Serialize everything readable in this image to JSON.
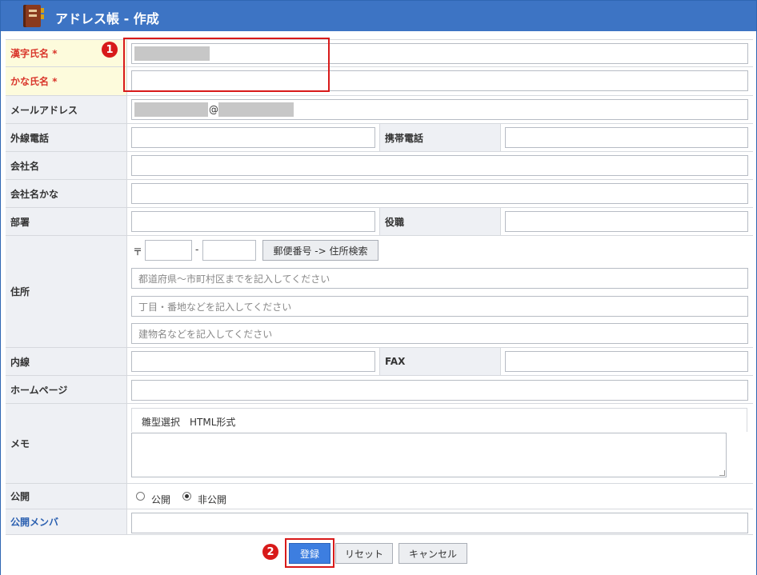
{
  "window": {
    "title": "アドレス帳 - 作成"
  },
  "form": {
    "kanji_name": {
      "label": "漢字氏名",
      "required_mark": "*"
    },
    "kana_name": {
      "label": "かな氏名",
      "required_mark": "*"
    },
    "email": {
      "label": "メールアドレス",
      "at": "@"
    },
    "phone": {
      "label": "外線電話"
    },
    "mobile": {
      "label": "携帯電話"
    },
    "company": {
      "label": "会社名"
    },
    "company_kana": {
      "label": "会社名かな"
    },
    "department": {
      "label": "部署"
    },
    "position": {
      "label": "役職"
    },
    "address": {
      "label": "住所",
      "postal_mark": "〒",
      "postal_dash": "-",
      "postal_search_button": "郵便番号 -> 住所検索",
      "line1_placeholder": "都道府県～市町村区までを記入してください",
      "line2_placeholder": "丁目・番地などを記入してください",
      "line3_placeholder": "建物名などを記入してください"
    },
    "extension": {
      "label": "内線"
    },
    "fax": {
      "label": "FAX"
    },
    "homepage": {
      "label": "ホームページ"
    },
    "memo": {
      "label": "メモ",
      "toolbar_text": "雛型選択　HTML形式"
    },
    "visibility": {
      "label": "公開",
      "options": [
        "公開",
        "非公開"
      ],
      "selected": "非公開"
    },
    "public_members": {
      "label": "公開メンバ"
    }
  },
  "actions": {
    "register": "登録",
    "reset": "リセット",
    "cancel": "キャンセル"
  },
  "annotations": {
    "badge1": "1",
    "badge2": "2"
  },
  "colors": {
    "titlebar": "#3d74c4",
    "required_label": "#d9362b",
    "highlight_box": "#d81a1a",
    "primary_button": "#3d7ee0"
  }
}
